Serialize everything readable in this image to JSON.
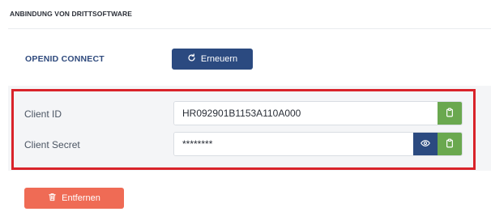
{
  "section": {
    "title": "ANBINDUNG VON DRITTSOFTWARE"
  },
  "openid": {
    "label": "OPENID CONNECT",
    "renew_button": {
      "label": "Erneuern",
      "icon": "refresh-icon"
    }
  },
  "credentials": {
    "client_id": {
      "label": "Client ID",
      "value": "HR092901B1153A110A000",
      "copy_icon": "clipboard-icon"
    },
    "client_secret": {
      "label": "Client Secret",
      "value": "********",
      "reveal_icon": "eye-icon",
      "copy_icon": "clipboard-icon"
    }
  },
  "remove_button": {
    "label": "Entfernen",
    "icon": "trash-icon"
  },
  "colors": {
    "primary": "#2b4a80",
    "success": "#6aa84f",
    "danger": "#ef6b55",
    "highlight": "#d9232a"
  }
}
